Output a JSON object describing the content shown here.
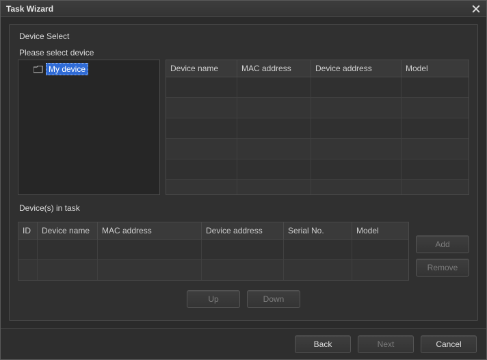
{
  "window": {
    "title": "Task Wizard"
  },
  "section": {
    "title": "Device Select",
    "select_label": "Please select device",
    "in_task_label": "Device(s) in task"
  },
  "tree": {
    "root_label": "My device"
  },
  "upper_grid": {
    "columns": [
      "Device name",
      "MAC address",
      "Device address",
      "Model"
    ],
    "rows": [
      [
        "",
        "",
        "",
        ""
      ],
      [
        "",
        "",
        "",
        ""
      ],
      [
        "",
        "",
        "",
        ""
      ],
      [
        "",
        "",
        "",
        ""
      ],
      [
        "",
        "",
        "",
        ""
      ],
      [
        "",
        "",
        "",
        ""
      ]
    ]
  },
  "lower_grid": {
    "columns": [
      "ID",
      "Device name",
      "MAC address",
      "Device address",
      "Serial No.",
      "Model"
    ],
    "rows": [
      [
        "",
        "",
        "",
        "",
        "",
        ""
      ],
      [
        "",
        "",
        "",
        "",
        "",
        ""
      ]
    ]
  },
  "buttons": {
    "add": "Add",
    "remove": "Remove",
    "up": "Up",
    "down": "Down",
    "back": "Back",
    "next": "Next",
    "cancel": "Cancel"
  },
  "state": {
    "add_disabled": true,
    "remove_disabled": true,
    "up_disabled": true,
    "down_disabled": true,
    "next_disabled": true
  },
  "colors": {
    "selection": "#2f6bd6"
  }
}
